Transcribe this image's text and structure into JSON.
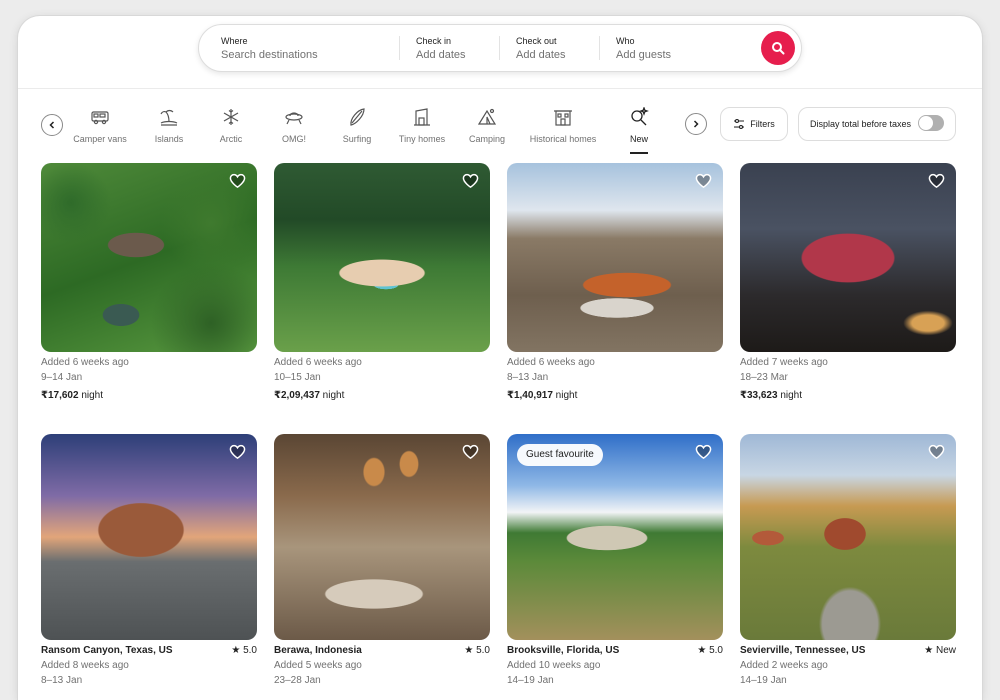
{
  "search": {
    "where_label": "Where",
    "where_value": "Search destinations",
    "checkin_label": "Check in",
    "checkin_value": "Add dates",
    "checkout_label": "Check out",
    "checkout_value": "Add dates",
    "who_label": "Who",
    "who_value": "Add guests",
    "button_icon": "search-icon",
    "accent": "#e61e4d"
  },
  "categories": [
    {
      "label": "Camper vans",
      "icon": "camper-van-icon"
    },
    {
      "label": "Islands",
      "icon": "island-icon"
    },
    {
      "label": "Arctic",
      "icon": "snowflake-icon"
    },
    {
      "label": "OMG!",
      "icon": "ufo-icon"
    },
    {
      "label": "Surfing",
      "icon": "surfboard-icon"
    },
    {
      "label": "Tiny homes",
      "icon": "tiny-home-icon"
    },
    {
      "label": "Camping",
      "icon": "tent-icon"
    },
    {
      "label": "Historical homes",
      "icon": "historical-home-icon"
    },
    {
      "label": "New",
      "icon": "new-sparkle-icon",
      "active": true
    }
  ],
  "filters_label": "Filters",
  "taxes_label": "Display total before taxes",
  "taxes_toggle_on": false,
  "listings_row1": [
    {
      "added": "Added 6 weeks ago",
      "dates": "9–14 Jan",
      "price": "₹17,602",
      "unit": " night"
    },
    {
      "added": "Added 6 weeks ago",
      "dates": "10–15 Jan",
      "price": "₹2,09,437",
      "unit": " night"
    },
    {
      "added": "Added 6 weeks ago",
      "dates": "8–13 Jan",
      "price": "₹1,40,917",
      "unit": " night"
    },
    {
      "added": "Added 7 weeks ago",
      "dates": "18–23 Mar",
      "price": "₹33,623",
      "unit": " night"
    }
  ],
  "listings_row2": [
    {
      "location": "Ransom Canyon, Texas, US",
      "rating": "5.0",
      "added": "Added 8 weeks ago",
      "dates": "8–13 Jan"
    },
    {
      "location": "Berawa, Indonesia",
      "rating": "5.0",
      "added": "Added 5 weeks ago",
      "dates": "23–28 Jan"
    },
    {
      "location": "Brooksville, Florida, US",
      "rating": "5.0",
      "added": "Added 10 weeks ago",
      "dates": "14–19 Jan",
      "badge": "Guest favourite"
    },
    {
      "location": "Sevierville, Tennessee, US",
      "rating": "New",
      "added": "Added 2 weeks ago",
      "dates": "14–19 Jan"
    }
  ]
}
